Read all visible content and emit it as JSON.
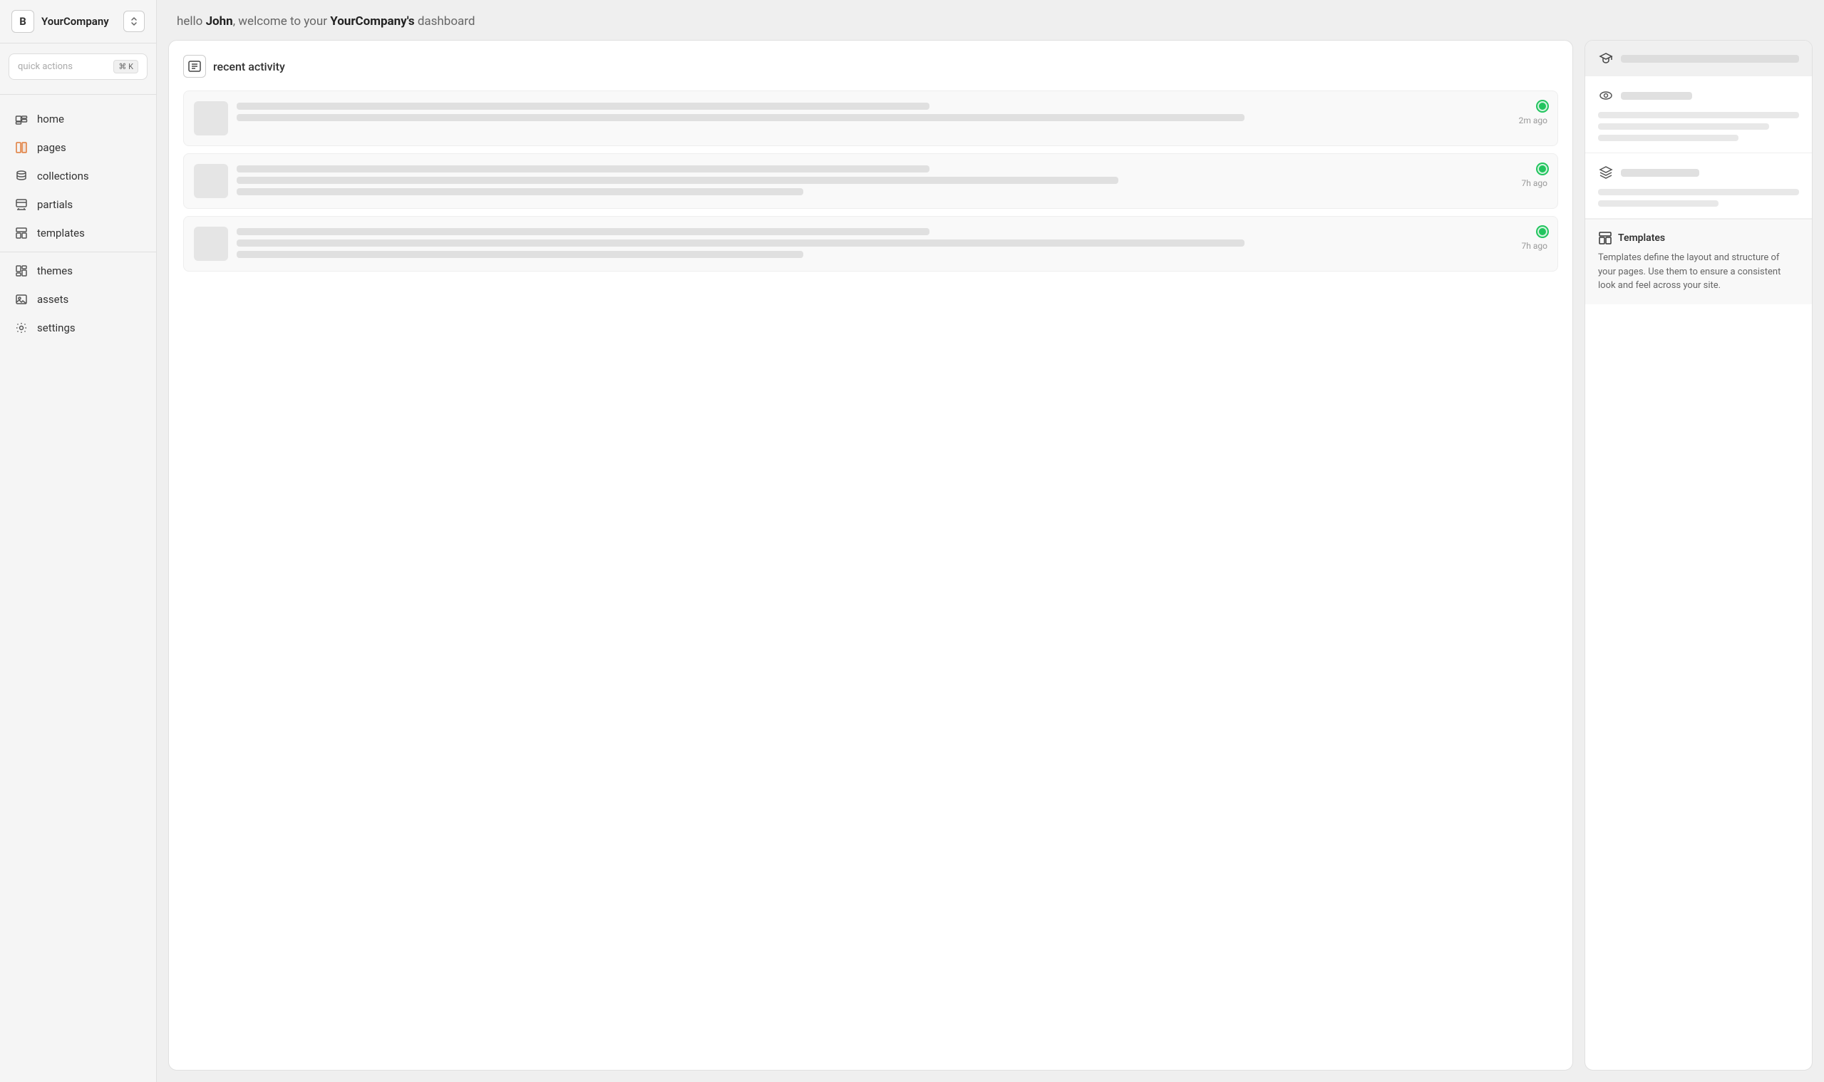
{
  "sidebar": {
    "brand": {
      "initial": "B",
      "name": "YourCompany"
    },
    "quick_actions": {
      "placeholder": "quick actions",
      "shortcut": "⌘ K"
    },
    "nav_items": [
      {
        "id": "home",
        "label": "home",
        "icon": "home-icon"
      },
      {
        "id": "pages",
        "label": "pages",
        "icon": "pages-icon",
        "accent": true
      },
      {
        "id": "collections",
        "label": "collections",
        "icon": "collections-icon"
      },
      {
        "id": "partials",
        "label": "partials",
        "icon": "partials-icon"
      },
      {
        "id": "templates",
        "label": "templates",
        "icon": "templates-icon"
      },
      {
        "id": "themes",
        "label": "themes",
        "icon": "themes-icon"
      },
      {
        "id": "assets",
        "label": "assets",
        "icon": "assets-icon"
      },
      {
        "id": "settings",
        "label": "settings",
        "icon": "settings-icon"
      }
    ]
  },
  "header": {
    "greeting_prefix": "hello ",
    "user": "John",
    "greeting_mid": ", welcome to your ",
    "company": "YourCompany's",
    "greeting_suffix": " dashboard"
  },
  "recent_activity": {
    "title": "recent activity",
    "items": [
      {
        "time": "2m ago"
      },
      {
        "time": "7h ago"
      },
      {
        "time": "7h ago"
      }
    ]
  },
  "right_panel": {
    "sections": [
      {
        "icon": "graduation-icon"
      },
      {
        "icon": "eye-icon"
      },
      {
        "icon": "layers-icon"
      }
    ],
    "templates_info": {
      "icon": "templates-grid-icon",
      "title": "Templates",
      "description": "Templates define the layout and structure of your pages. Use them to ensure a consistent look and feel across your site."
    }
  }
}
